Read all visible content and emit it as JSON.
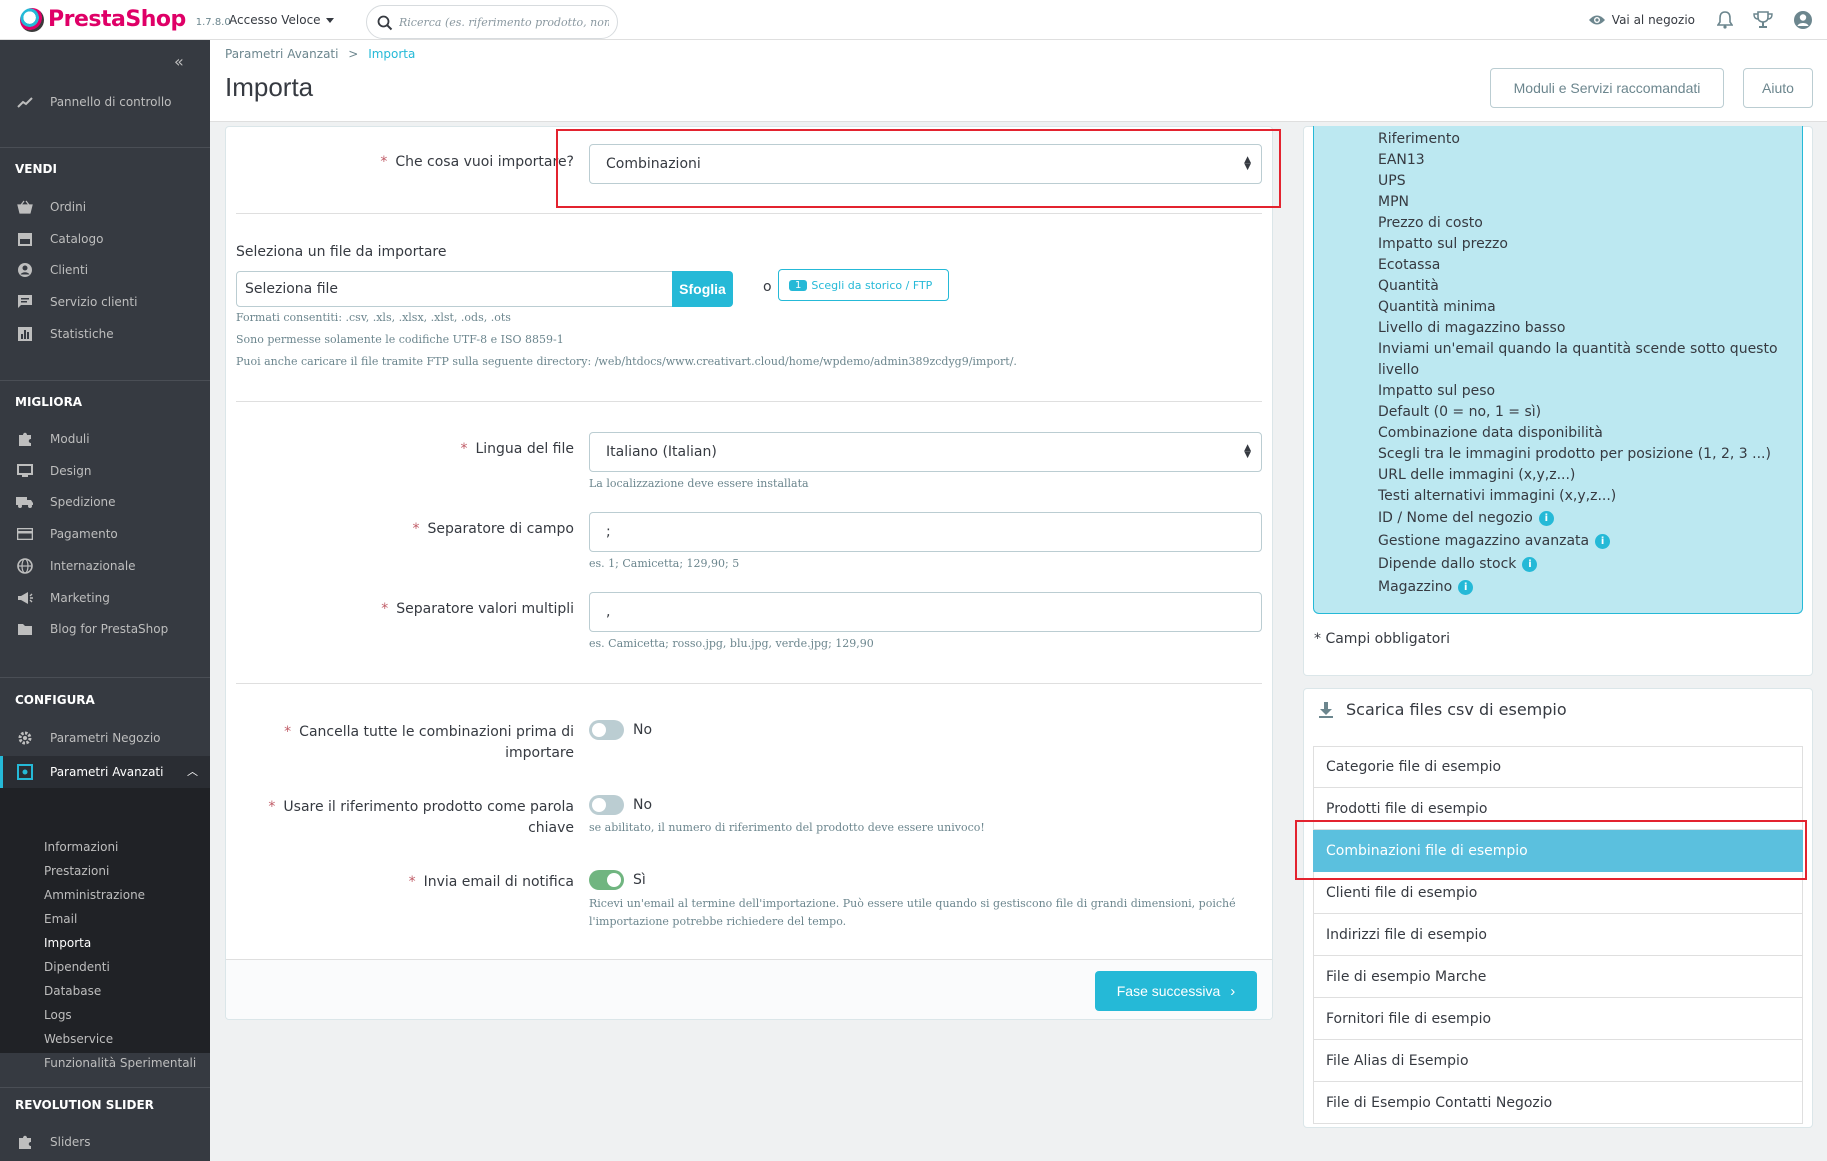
{
  "brand": {
    "name": "PrestaShop",
    "version": "1.7.8.0"
  },
  "topbar": {
    "quick_access": "Accesso Veloce",
    "search_placeholder": "Ricerca (es. riferimento prodotto, nom",
    "visit_store": "Vai al negozio"
  },
  "sidebar": {
    "dashboard": "Pannello di controllo",
    "sections": {
      "sell": "VENDI",
      "improve": "MIGLIORA",
      "configure": "CONFIGURA",
      "revslider": "REVOLUTION SLIDER"
    },
    "sell_items": [
      "Ordini",
      "Catalogo",
      "Clienti",
      "Servizio clienti",
      "Statistiche"
    ],
    "improve_items": [
      "Moduli",
      "Design",
      "Spedizione",
      "Pagamento",
      "Internazionale",
      "Marketing",
      "Blog for PrestaShop"
    ],
    "configure_items": [
      "Parametri Negozio",
      "Parametri Avanzati"
    ],
    "advanced_sub": [
      "Informazioni",
      "Prestazioni",
      "Amministrazione",
      "Email",
      "Importa",
      "Dipendenti",
      "Database",
      "Logs",
      "Webservice",
      "Funzionalità Sperimentali"
    ],
    "revslider_items": [
      "Sliders"
    ]
  },
  "header": {
    "breadcrumb_parent": "Parametri Avanzati",
    "breadcrumb_current": "Importa",
    "title": "Importa",
    "btn_modules": "Moduli e Servizi raccomandati",
    "btn_help": "Aiuto"
  },
  "form": {
    "what_import_label": "Che cosa vuoi importare?",
    "what_import_value": "Combinazioni",
    "select_file_label": "Seleziona un file da importare",
    "select_file_placeholder": "Seleziona file",
    "browse_btn": "Sfoglia",
    "or": "o",
    "history_count": "1",
    "history_btn": "Scegli da storico / FTP",
    "help_formats": "Formati consentiti: .csv, .xls, .xlsx, .xlst, .ods, .ots",
    "help_encoding": "Sono permesse solamente le codifiche UTF-8 e ISO 8859-1",
    "help_ftp": "Puoi anche caricare il file tramite FTP sulla seguente directory: /web/htdocs/www.creativart.cloud/home/wpdemo/admin389zcdyg9/import/.",
    "lang_label": "Lingua del file",
    "lang_value": "Italiano (Italian)",
    "lang_help": "La localizzazione deve essere installata",
    "field_sep_label": "Separatore di campo",
    "field_sep_value": ";",
    "field_sep_help": "es. 1; Camicetta; 129,90; 5",
    "multi_sep_label": "Separatore valori multipli",
    "multi_sep_value": ",",
    "multi_sep_help": "es. Camicetta; rosso.jpg, blu.jpg, verde.jpg; 129,90",
    "delete_label_1": "Cancella tutte le combinazioni prima di",
    "delete_label_2": "importare",
    "delete_value": "No",
    "useref_label_1": "Usare il riferimento prodotto come parola",
    "useref_label_2": "chiave",
    "useref_value": "No",
    "useref_help": "se abilitato, il numero di riferimento del prodotto deve essere univoco!",
    "notify_label": "Invia email di notifica",
    "notify_value": "Sì",
    "notify_help_1": "Ricevi un'email al termine dell'importazione. Può essere utile quando si gestiscono file di grandi dimensioni, poiché",
    "notify_help_2": "l'importazione potrebbe richiedere del tempo.",
    "next_btn": "Fase successiva"
  },
  "fields": {
    "items": [
      "Riferimento",
      "EAN13",
      "UPS",
      "MPN",
      "Prezzo di costo",
      "Impatto sul prezzo",
      "Ecotassa",
      "Quantità",
      "Quantità minima",
      "Livello di magazzino basso",
      "Inviami un'email quando la quantità scende sotto questo",
      "livello",
      "Impatto sul peso",
      "Default (0 = no, 1 = sì)",
      "Combinazione data disponibilità",
      "Scegli tra le immagini prodotto per posizione (1, 2, 3 ...)",
      "URL delle immagini (x,y,z...)",
      "Testi alternativi immagini (x,y,z...)"
    ],
    "info_items": [
      "ID / Nome del negozio",
      "Gestione magazzino avanzata",
      "Dipende dallo stock",
      "Magazzino"
    ],
    "required_note": "* Campi obbligatori"
  },
  "samples": {
    "title": "Scarica files csv di esempio",
    "items": [
      "Categorie file di esempio",
      "Prodotti file di esempio",
      "Combinazioni file di esempio",
      "Clienti file di esempio",
      "Indirizzi file di esempio",
      "File di esempio Marche",
      "Fornitori file di esempio",
      "File Alias di Esempio",
      "File di Esempio Contatti Negozio"
    ]
  },
  "colors": {
    "accent": "#25b9d7",
    "brand": "#df0067",
    "highlight": "#e3232f",
    "toggle_on": "#70b580"
  }
}
